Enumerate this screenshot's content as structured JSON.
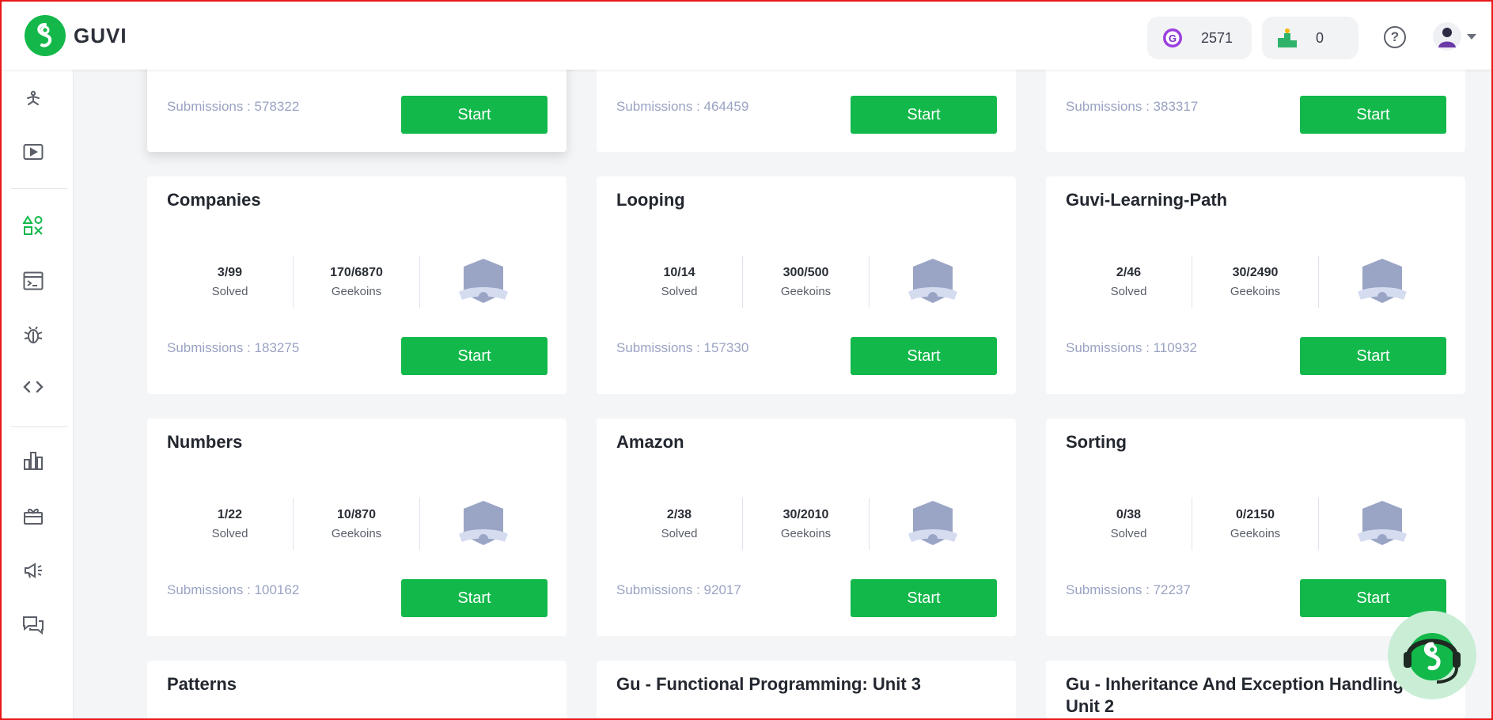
{
  "header": {
    "brand": "GUVI",
    "coins": "2571",
    "rank": "0"
  },
  "sidebar": {
    "icons": [
      "yoga-icon",
      "video-icon",
      "shapes-icon",
      "terminal-icon",
      "bug-icon",
      "code-icon",
      "leaderboard-icon",
      "gift-icon",
      "megaphone-icon",
      "forum-icon"
    ]
  },
  "top_cards": [
    {
      "submissions": "Submissions : 578322",
      "start": "Start"
    },
    {
      "submissions": "Submissions : 464459",
      "start": "Start"
    },
    {
      "submissions": "Submissions : 383317",
      "start": "Start"
    }
  ],
  "row2": [
    {
      "title": "Companies",
      "solved": "3/99",
      "solved_label": "Solved",
      "geekoins": "170/6870",
      "geekoins_label": "Geekoins",
      "submissions": "Submissions : 183275",
      "start": "Start"
    },
    {
      "title": "Looping",
      "solved": "10/14",
      "solved_label": "Solved",
      "geekoins": "300/500",
      "geekoins_label": "Geekoins",
      "submissions": "Submissions : 157330",
      "start": "Start"
    },
    {
      "title": "Guvi-Learning-Path",
      "solved": "2/46",
      "solved_label": "Solved",
      "geekoins": "30/2490",
      "geekoins_label": "Geekoins",
      "submissions": "Submissions : 110932",
      "start": "Start"
    }
  ],
  "row3": [
    {
      "title": "Numbers",
      "solved": "1/22",
      "solved_label": "Solved",
      "geekoins": "10/870",
      "geekoins_label": "Geekoins",
      "submissions": "Submissions : 100162",
      "start": "Start"
    },
    {
      "title": "Amazon",
      "solved": "2/38",
      "solved_label": "Solved",
      "geekoins": "30/2010",
      "geekoins_label": "Geekoins",
      "submissions": "Submissions : 92017",
      "start": "Start"
    },
    {
      "title": "Sorting",
      "solved": "0/38",
      "solved_label": "Solved",
      "geekoins": "0/2150",
      "geekoins_label": "Geekoins",
      "submissions": "Submissions : 72237",
      "start": "Start"
    }
  ],
  "row4": [
    {
      "title": "Patterns"
    },
    {
      "title": "Gu - Functional Programming: Unit 3"
    },
    {
      "title": "Gu - Inheritance And Exception Handling: Unit 2"
    }
  ],
  "colors": {
    "accent": "#13b84b",
    "badge": "#9aa5c6",
    "submissions_text": "#9aa3c3"
  }
}
